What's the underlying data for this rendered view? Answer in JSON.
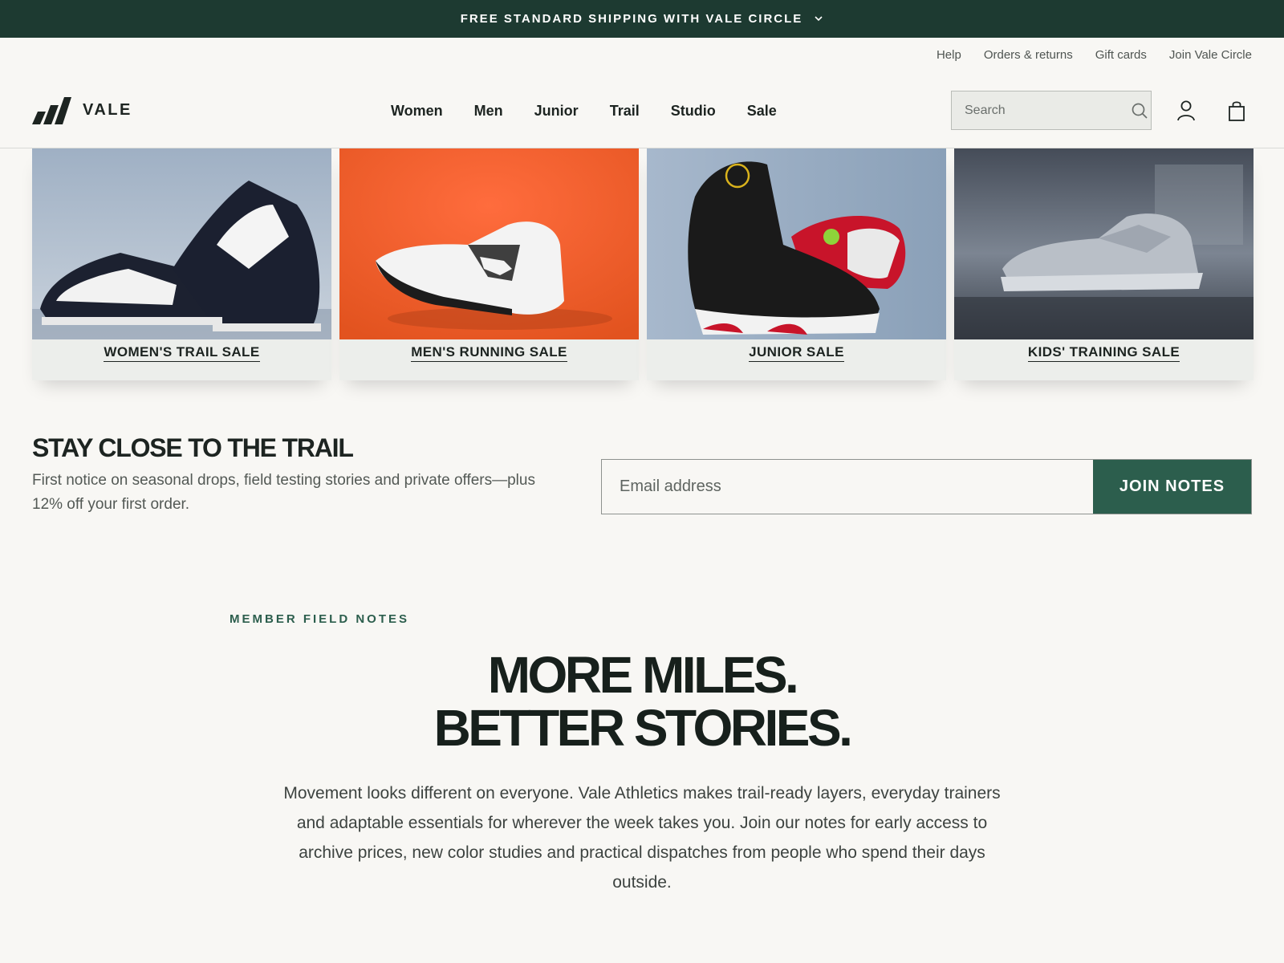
{
  "announcement": {
    "text": "FREE STANDARD SHIPPING WITH VALE CIRCLE",
    "icon": "chevron-down-icon"
  },
  "utility_nav": [
    {
      "label": "Help"
    },
    {
      "label": "Orders & returns"
    },
    {
      "label": "Gift cards"
    },
    {
      "label": "Join Vale Circle"
    }
  ],
  "brand": {
    "name": "VALE"
  },
  "main_nav": [
    {
      "label": "Women"
    },
    {
      "label": "Men"
    },
    {
      "label": "Junior"
    },
    {
      "label": "Trail"
    },
    {
      "label": "Studio"
    },
    {
      "label": "Sale"
    }
  ],
  "search": {
    "placeholder": "Search",
    "icon": "search-icon"
  },
  "header_icons": {
    "account": "account-icon",
    "bag": "shopping-bag-icon"
  },
  "tiles": [
    {
      "label": "WOMEN'S TRAIL SALE"
    },
    {
      "label": "MEN'S RUNNING SALE"
    },
    {
      "label": "JUNIOR SALE"
    },
    {
      "label": "KIDS' TRAINING SALE"
    }
  ],
  "newsletter": {
    "title": "STAY CLOSE TO THE TRAIL",
    "subtitle": "First notice on seasonal drops, field testing stories and private offers—plus 12% off your first order.",
    "email_placeholder": "Email address",
    "button_label": "JOIN NOTES"
  },
  "story": {
    "eyebrow": "MEMBER FIELD NOTES",
    "headline_line1": "MORE MILES.",
    "headline_line2": "BETTER STORIES.",
    "body": "Movement looks different on everyone. Vale Athletics makes trail-ready layers, everyday trainers and adaptable essentials for wherever the week takes you. Join our notes for early access to archive prices, new color studies and practical dispatches from people who spend their days outside."
  },
  "colors": {
    "announcement_bg": "#1d3a31",
    "accent_green": "#2c5e4d",
    "page_bg": "#f8f7f4",
    "text_dark": "#1d2421"
  }
}
